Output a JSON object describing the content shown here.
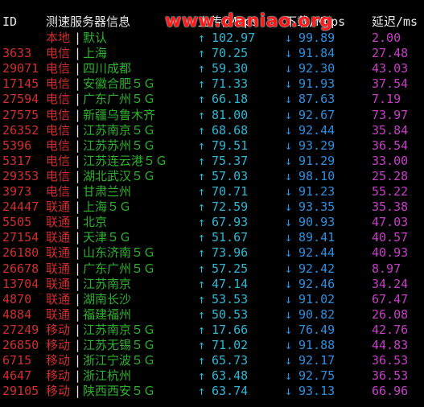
{
  "header": {
    "id": "ID",
    "server": "测速服务器信息",
    "upload": "上传/Mbps",
    "download": "下载/Mbps",
    "ping": "延迟/ms"
  },
  "watermark": "www.daniao.org",
  "separator": "|",
  "up_arrow": "↑",
  "down_arrow": "↓",
  "colors": {
    "id": "#d22e2e",
    "isp": "#d22e2e",
    "city": "#2fb12f",
    "upload": "#2db7d4",
    "download": "#2d8fe0",
    "ping": "#c73ec7",
    "watermark": "#ff1a1a"
  },
  "rows": [
    {
      "id": "",
      "isp": "本地",
      "city": "默认",
      "up": "102.97",
      "down": "99.89",
      "ping": "2.00"
    },
    {
      "id": "3633",
      "isp": "电信",
      "city": "上海",
      "up": "70.25",
      "down": "91.84",
      "ping": "27.48"
    },
    {
      "id": "29071",
      "isp": "电信",
      "city": "四川成都",
      "up": "59.30",
      "down": "92.30",
      "ping": "43.03"
    },
    {
      "id": "17145",
      "isp": "电信",
      "city": "安徽合肥５Ｇ",
      "up": "71.33",
      "down": "91.93",
      "ping": "37.54"
    },
    {
      "id": "27594",
      "isp": "电信",
      "city": "广东广州５Ｇ",
      "up": "66.18",
      "down": "87.63",
      "ping": "7.19"
    },
    {
      "id": "27575",
      "isp": "电信",
      "city": "新疆乌鲁木齐",
      "up": "81.00",
      "down": "92.67",
      "ping": "73.97"
    },
    {
      "id": "26352",
      "isp": "电信",
      "city": "江苏南京５Ｇ",
      "up": "68.68",
      "down": "92.44",
      "ping": "35.84"
    },
    {
      "id": "5396",
      "isp": "电信",
      "city": "江苏苏州５Ｇ",
      "up": "79.51",
      "down": "93.29",
      "ping": "36.54"
    },
    {
      "id": "5317",
      "isp": "电信",
      "city": "江苏连云港５Ｇ",
      "up": "75.37",
      "down": "91.29",
      "ping": "33.00"
    },
    {
      "id": "29353",
      "isp": "电信",
      "city": "湖北武汉５Ｇ",
      "up": "57.03",
      "down": "98.10",
      "ping": "25.28"
    },
    {
      "id": "3973",
      "isp": "电信",
      "city": "甘肃兰州",
      "up": "70.71",
      "down": "91.23",
      "ping": "55.22"
    },
    {
      "id": "24447",
      "isp": "联通",
      "city": "上海５Ｇ",
      "up": "72.59",
      "down": "93.35",
      "ping": "35.38"
    },
    {
      "id": "5505",
      "isp": "联通",
      "city": "北京",
      "up": "67.93",
      "down": "90.93",
      "ping": "47.03"
    },
    {
      "id": "27154",
      "isp": "联通",
      "city": "天津５Ｇ",
      "up": "51.67",
      "down": "89.41",
      "ping": "40.57"
    },
    {
      "id": "26180",
      "isp": "联通",
      "city": "山东济南５Ｇ",
      "up": "73.96",
      "down": "92.44",
      "ping": "40.93"
    },
    {
      "id": "26678",
      "isp": "联通",
      "city": "广东广州５Ｇ",
      "up": "57.25",
      "down": "92.42",
      "ping": "8.97"
    },
    {
      "id": "13704",
      "isp": "联通",
      "city": "江苏南京",
      "up": "47.14",
      "down": "92.46",
      "ping": "34.24"
    },
    {
      "id": "4870",
      "isp": "联通",
      "city": "湖南长沙",
      "up": "53.53",
      "down": "91.02",
      "ping": "67.47"
    },
    {
      "id": "4884",
      "isp": "联通",
      "city": "福建福州",
      "up": "50.53",
      "down": "90.82",
      "ping": "26.08"
    },
    {
      "id": "27249",
      "isp": "移动",
      "city": "江苏南京５Ｇ",
      "up": "17.66",
      "down": "76.49",
      "ping": "42.76"
    },
    {
      "id": "26850",
      "isp": "移动",
      "city": "江苏无锡５Ｇ",
      "up": "71.02",
      "down": "91.88",
      "ping": "44.83"
    },
    {
      "id": "6715",
      "isp": "移动",
      "city": "浙江宁波５Ｇ",
      "up": "65.73",
      "down": "92.17",
      "ping": "36.53"
    },
    {
      "id": "4647",
      "isp": "移动",
      "city": "浙江杭州",
      "up": "63.48",
      "down": "92.75",
      "ping": "36.53"
    },
    {
      "id": "29105",
      "isp": "移动",
      "city": "陕西西安５Ｇ",
      "up": "63.74",
      "down": "93.13",
      "ping": "66.96"
    }
  ]
}
